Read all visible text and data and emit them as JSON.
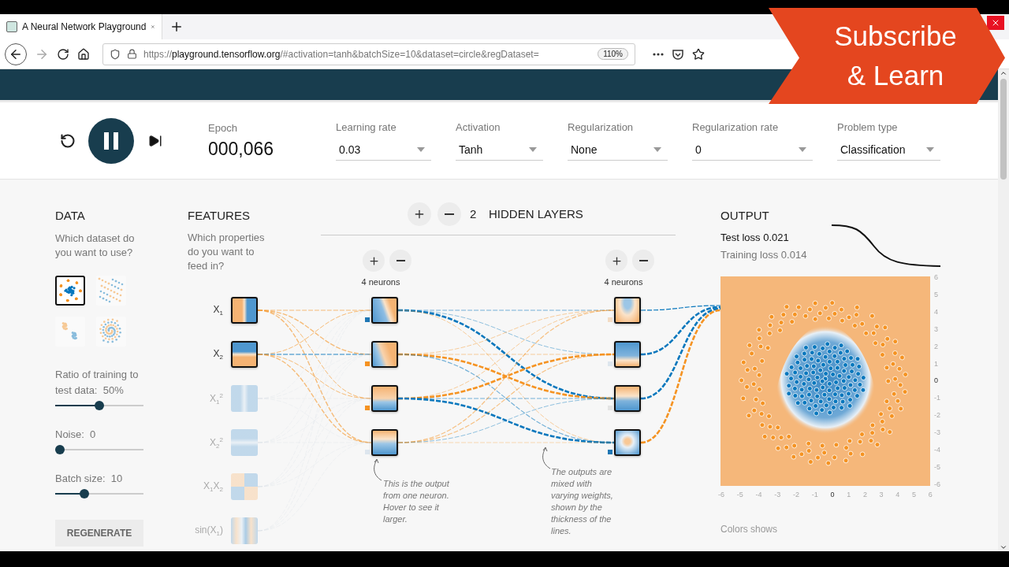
{
  "browser": {
    "tab_title": "A Neural Network Playground",
    "url_scheme": "https://",
    "url_domain": "playground.tensorflow.org",
    "url_path": "/#activation=tanh&batchSize=10&dataset=circle&regDataset=",
    "zoom": "110%"
  },
  "overlay_banner": {
    "lines": [
      "Subscribe",
      "& Learn"
    ]
  },
  "controls": {
    "playing": true,
    "epoch_label": "Epoch",
    "epoch": "000,066",
    "dropdowns": [
      {
        "label": "Learning rate",
        "value": "0.03"
      },
      {
        "label": "Activation",
        "value": "Tanh"
      },
      {
        "label": "Regularization",
        "value": "None"
      },
      {
        "label": "Regularization rate",
        "value": "0"
      },
      {
        "label": "Problem type",
        "value": "Classification"
      }
    ]
  },
  "data": {
    "title": "DATA",
    "prompt": "Which dataset do you want to use?",
    "datasets": [
      {
        "kind": "circle",
        "selected": true
      },
      {
        "kind": "xor",
        "selected": false
      },
      {
        "kind": "gauss",
        "selected": false
      },
      {
        "kind": "spiral",
        "selected": false
      }
    ],
    "sliders": [
      {
        "label": "Ratio of training to test data:",
        "reading": "50%",
        "level": 0.5
      },
      {
        "label": "Noise:",
        "reading": "0",
        "level": 0
      },
      {
        "label": "Batch size:",
        "reading": "10",
        "level": 0.31
      }
    ],
    "regenerate": "REGENERATE"
  },
  "features": {
    "title": "FEATURES",
    "prompt": "Which properties do you want to feed in?",
    "items": [
      {
        "label": "X$_{1}$",
        "selected": true
      },
      {
        "label": "X$_{2}$",
        "selected": true
      },
      {
        "label": "X$_{1}$$^{2}$",
        "selected": false
      },
      {
        "label": "X$_{2}$$^{2}$",
        "selected": false
      },
      {
        "label": "X$_{1}$X$_{2}$",
        "selected": false
      },
      {
        "label": "sin(X$_{1}$)",
        "selected": false
      }
    ]
  },
  "network": {
    "hidden_count": "2",
    "hidden_label": "HIDDEN LAYERS",
    "layers": [
      {
        "label": "4 neurons",
        "neurons": [
          {
            "color": "#1f77b4"
          },
          {
            "color": "#f59322"
          },
          {
            "color": "#f59322"
          },
          {
            "color": "#dde6ee"
          }
        ]
      },
      {
        "label": "4 neurons",
        "neurons": [
          {
            "color": "#f3dcc4"
          },
          {
            "color": "#dde6ee"
          },
          {
            "color": "#e4e4e4"
          },
          {
            "color": "#1f77b4"
          }
        ]
      }
    ],
    "notes": [
      "This is the output from one neuron. Hover to see it larger.",
      "The outputs are mixed with varying weights, shown by the thickness of the lines."
    ]
  },
  "output": {
    "title": "OUTPUT",
    "test_loss": "Test loss 0.021",
    "training_loss": "Training loss 0.014",
    "y_ticks": [
      "6",
      "5",
      "4",
      "3",
      "2",
      "1",
      "0",
      "-1",
      "-2",
      "-3",
      "-4",
      "-5",
      "-6"
    ],
    "x_ticks": [
      "-6",
      "-5",
      "-4",
      "-3",
      "-2",
      "-1",
      "0",
      "1",
      "2",
      "3",
      "4",
      "5",
      "6"
    ],
    "colors_note": "Colors shows"
  }
}
